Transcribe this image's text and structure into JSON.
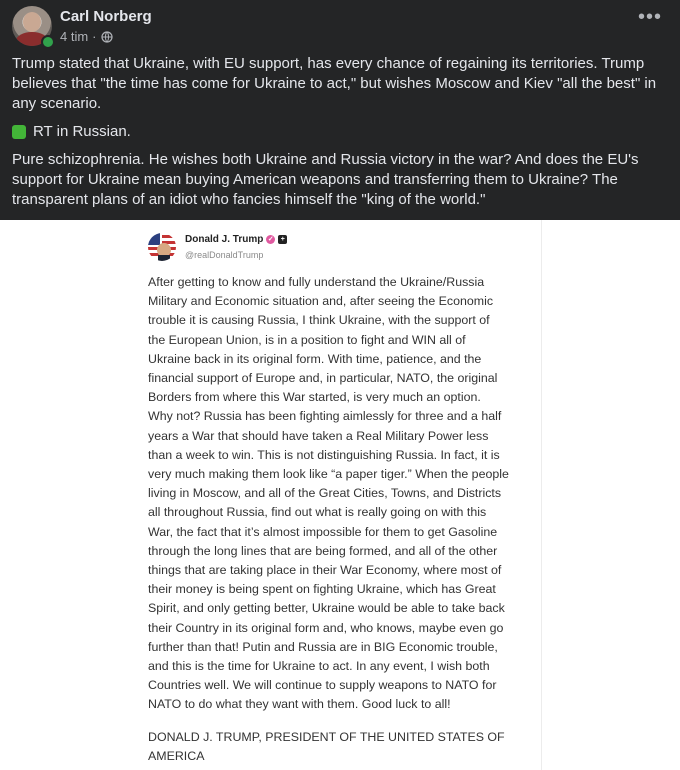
{
  "post": {
    "author": "Carl Norberg",
    "time": "4 tim",
    "separator": "·",
    "paragraph1": "Trump stated that Ukraine, with EU support, has every chance of regaining its territories. Trump believes that \"the time has come for Ukraine to act,\" but wishes Moscow and Kiev \"all the best\" in any scenario.",
    "paragraph2": "RT in Russian.",
    "paragraph3": "Pure schizophrenia. He wishes both Ukraine and Russia victory in the war? And does the EU's support for Ukraine mean buying American weapons and transferring them to Ukraine? The transparent plans of an idiot who fancies himself the \"king of the world.\"",
    "more_icon": "more-horizontal-icon",
    "globe_icon": "globe-icon"
  },
  "embedded_post": {
    "name": "Donald J. Trump",
    "handle": "@realDonaldTrump",
    "body": "After getting to know and fully understand the Ukraine/Russia\nMilitary and Economic situation and, after seeing the Economic\ntrouble it is causing Russia, I think Ukraine, with the support of\nthe European Union, is in a position to fight and WIN all of\nUkraine back in its original form. With time, patience, and the\nfinancial support of Europe and, in particular, NATO, the original\nBorders from where this War started, is very much an option.\nWhy not? Russia has been fighting aimlessly for three and a half\nyears a War that should have taken a Real Military Power less\nthan a week to win. This is not distinguishing Russia. In fact, it is\nvery much making them look like “a paper tiger.” When the people\nliving in Moscow, and all of the Great Cities, Towns, and Districts\nall throughout Russia, find out what is really going on with this\nWar, the fact that it’s almost impossible for them to get Gasoline\nthrough the long lines that are being formed, and all of the other\nthings that are taking place in their War Economy, where most of\ntheir money is being spent on fighting Ukraine, which has Great\nSpirit, and only getting better, Ukraine would be able to take back\ntheir Country in its original form and, who knows, maybe even go\nfurther than that! Putin and Russia are in BIG Economic trouble,\nand this is the time for Ukraine to act. In any event, I wish both\nCountries well. We will continue to supply weapons to NATO for\nNATO to do what they want with them. Good luck to all!",
    "signature": "DONALD J. TRUMP, PRESIDENT OF THE UNITED STATES OF\nAMERICA"
  },
  "colors": {
    "background": "#242526",
    "text": "#e4e6eb",
    "secondary_text": "#b0b3b8",
    "online": "#31a24c",
    "green_square": "#43b538"
  }
}
